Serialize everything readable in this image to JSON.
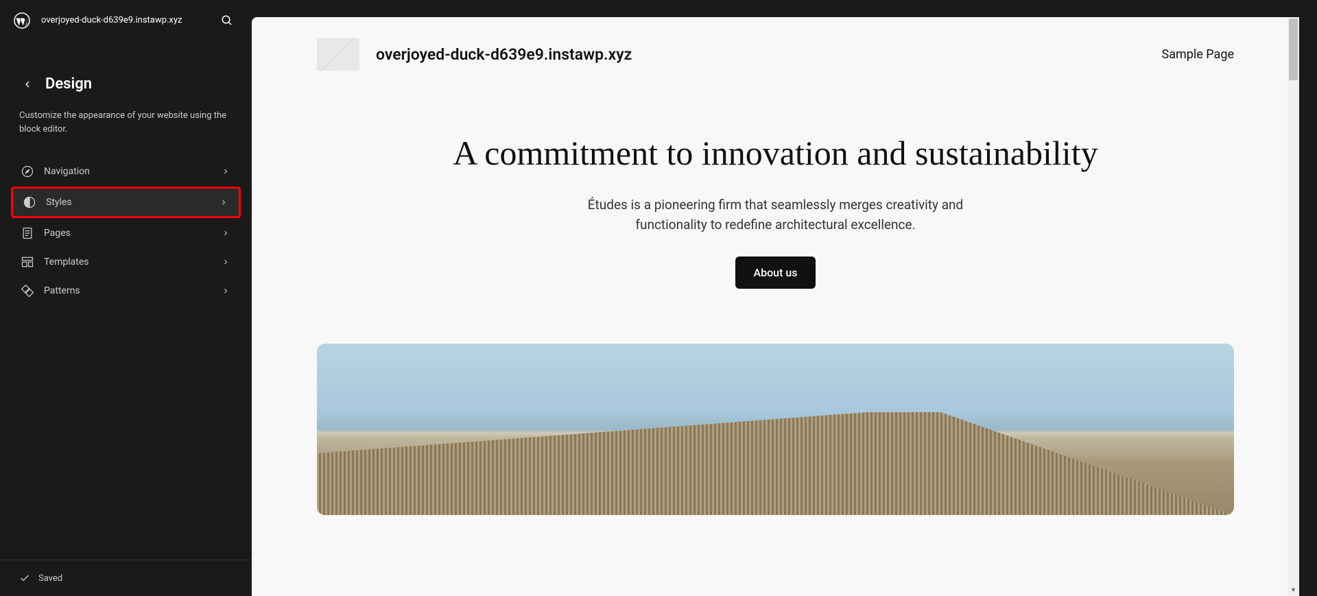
{
  "header": {
    "site_name": "overjoyed-duck-d639e9.instawp.xyz"
  },
  "panel": {
    "title": "Design",
    "description": "Customize the appearance of your website using the block editor."
  },
  "menu": {
    "items": [
      {
        "label": "Navigation",
        "highlighted": false
      },
      {
        "label": "Styles",
        "highlighted": true
      },
      {
        "label": "Pages",
        "highlighted": false
      },
      {
        "label": "Templates",
        "highlighted": false
      },
      {
        "label": "Patterns",
        "highlighted": false
      }
    ]
  },
  "footer": {
    "status": "Saved"
  },
  "preview": {
    "site_title": "overjoyed-duck-d639e9.instawp.xyz",
    "nav_link": "Sample Page",
    "hero_title": "A commitment to innovation and sustainability",
    "hero_desc": "Études is a pioneering firm that seamlessly merges creativity and functionality to redefine architectural excellence.",
    "hero_button": "About us"
  }
}
